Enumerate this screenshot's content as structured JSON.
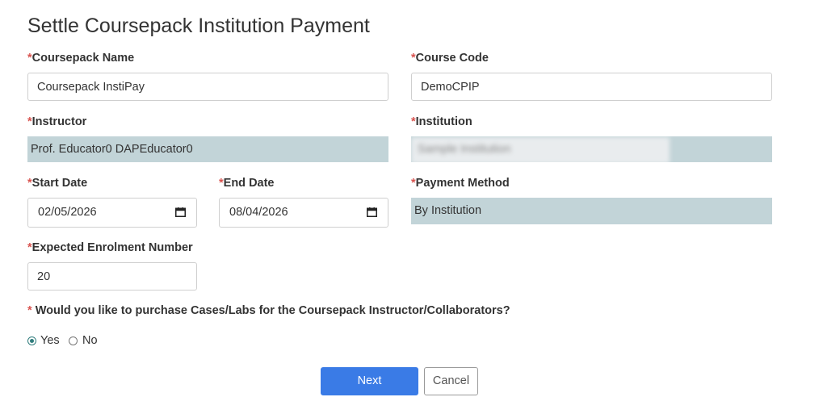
{
  "page": {
    "title": "Settle Coursepack Institution Payment"
  },
  "form": {
    "required_marker": "*",
    "coursepack_name": {
      "label": "Coursepack Name",
      "value": "Coursepack InstiPay"
    },
    "course_code": {
      "label": "Course Code",
      "value": "DemoCPIP"
    },
    "instructor": {
      "label": "Instructor",
      "value": "Prof. Educator0 DAPEducator0"
    },
    "institution": {
      "label": "Institution",
      "value": "Sample Institution"
    },
    "start_date": {
      "label": "Start Date",
      "value": "02/05/2026"
    },
    "end_date": {
      "label": "End Date",
      "value": "08/04/2026"
    },
    "payment_method": {
      "label": "Payment Method",
      "value": "By Institution"
    },
    "expected_enrolment": {
      "label": "Expected Enrolment Number",
      "value": "20"
    },
    "purchase_question": {
      "label": "Would you like to purchase Cases/Labs for the Coursepack Instructor/Collaborators?",
      "options": [
        {
          "label": "Yes",
          "selected": true
        },
        {
          "label": "No",
          "selected": false
        }
      ]
    }
  },
  "actions": {
    "next_label": "Next",
    "cancel_label": "Cancel"
  },
  "icons": {
    "date_picker": "calendar-icon"
  },
  "colors": {
    "required": "#d9534f",
    "readonly_bg": "#c2d4d8",
    "primary": "#3a7be6",
    "radio_selected": "#2f7c7c"
  }
}
